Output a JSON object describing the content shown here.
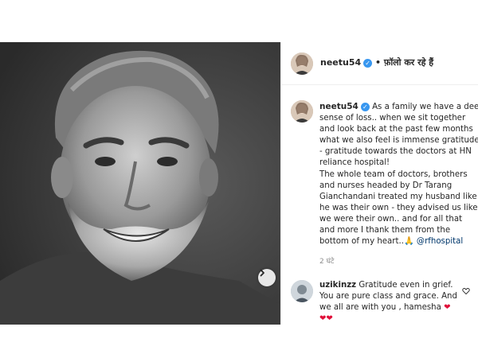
{
  "header": {
    "username": "neetu54",
    "separator": " • ",
    "follow_status": "फ़ॉलो कर रहे हैं"
  },
  "caption": {
    "username": "neetu54",
    "lines": [
      "As a family we have a deep",
      "sense of loss.. when we sit together",
      "and look back at the past few months",
      "what we also feel is immense gratitude",
      "- gratitude towards the doctors at HN",
      "reliance hospital!",
      "The whole team of doctors, brothers",
      "and nurses headed by Dr Tarang",
      "Gianchandani treated my husband like",
      "he was their own - they advised us like",
      "we were their own.. and for all that",
      "and more I thank them from the",
      "bottom of my heart.."
    ],
    "emoji": "🙏",
    "mention": "@rfhospital",
    "timestamp": "2 घंटे"
  },
  "comment": {
    "username": "uzikinzz",
    "lines": [
      "Gratitude even in grief.",
      "You are pure class and grace. And",
      "we all are with you , hamesha"
    ],
    "hearts": "❤",
    "hearts_row": "❤❤"
  },
  "icons": {
    "verified": "verified-badge-icon",
    "next": "chevron-right-icon",
    "like": "heart-outline-icon"
  },
  "colors": {
    "accent_blue": "#3897f0",
    "mention": "#00376b",
    "heart_red": "#e0103a",
    "muted": "#8e8e8e"
  }
}
